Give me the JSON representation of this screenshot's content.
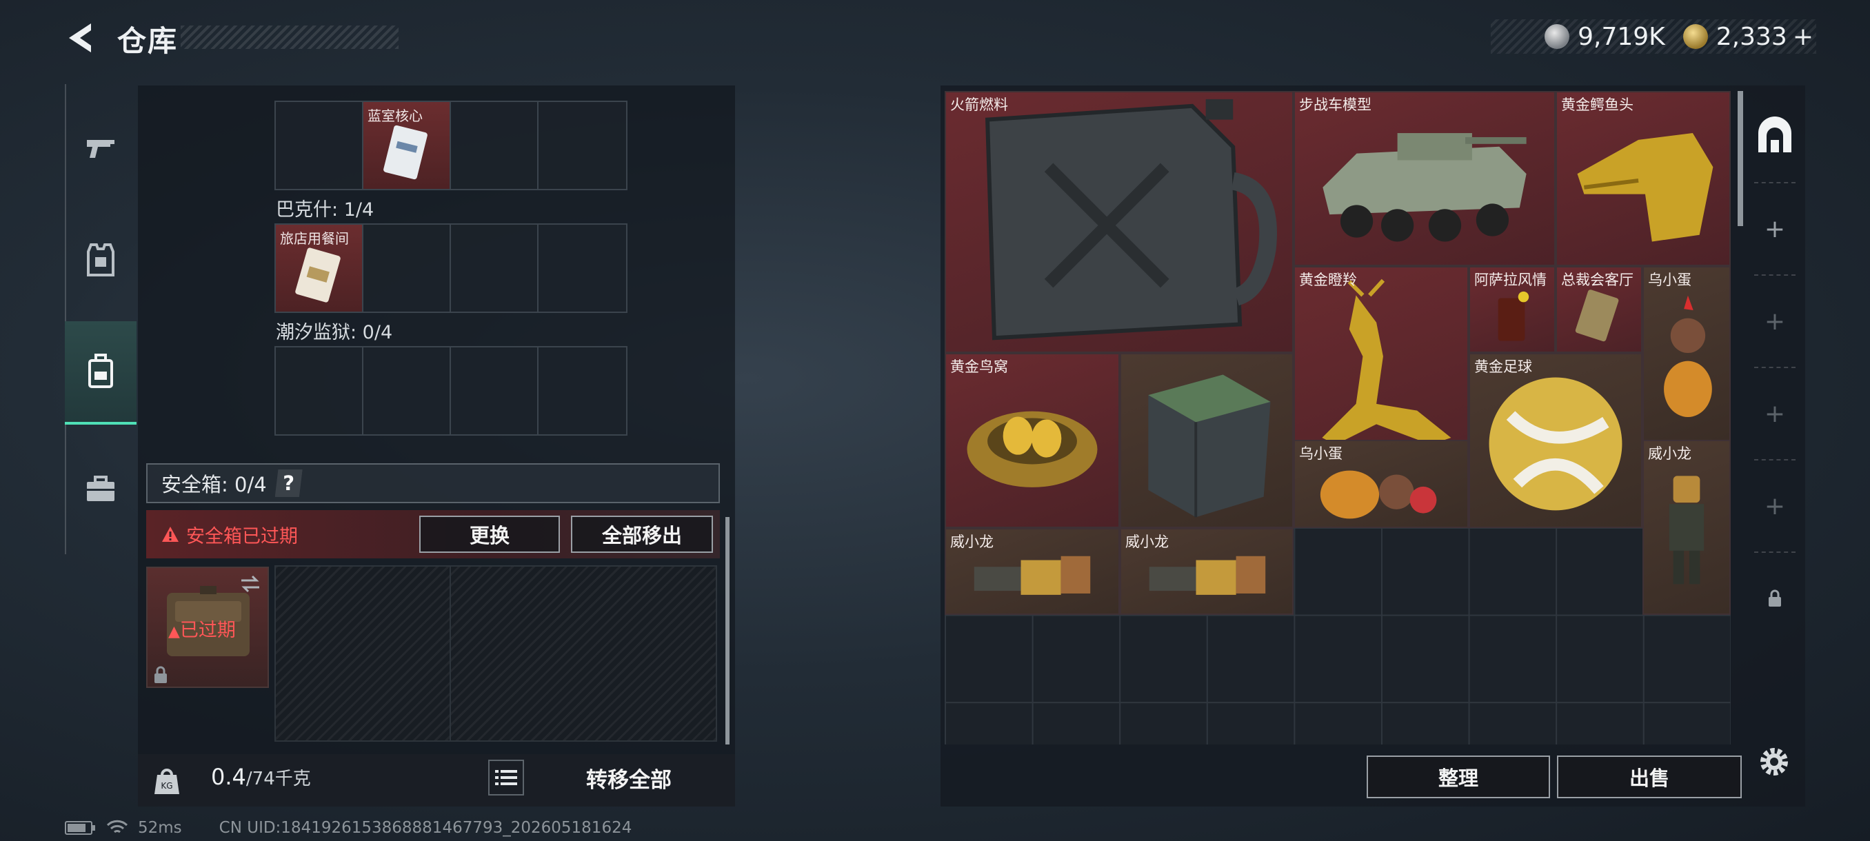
{
  "header": {
    "title": "仓库"
  },
  "currency": [
    {
      "icon": "silver-coin-icon",
      "value": "9,719K"
    },
    {
      "icon": "gold-coin-icon",
      "value": "2,333",
      "add_label": "+"
    }
  ],
  "left_tabs": [
    {
      "icon": "gun-icon"
    },
    {
      "icon": "armor-icon"
    },
    {
      "icon": "backpack-icon",
      "active": true
    },
    {
      "icon": "briefcase-icon"
    }
  ],
  "key_sections": [
    {
      "label": "",
      "items": [
        {
          "slot": 1,
          "name": "蓝室核心"
        }
      ]
    },
    {
      "label": "巴克什: 1/4",
      "items": [
        {
          "slot": 0,
          "name": "旅店用餐间"
        }
      ]
    },
    {
      "label": "潮汐监狱: 0/4",
      "items": []
    }
  ],
  "safe_box": {
    "label": "安全箱: 0/4",
    "help": "?",
    "warning": "安全箱已过期",
    "replace_label": "更换",
    "move_all_label": "全部移出",
    "case_status": "已过期"
  },
  "bottom": {
    "weight_value": "0.4",
    "weight_max": "/74千克",
    "transfer_label": "转移全部"
  },
  "status": {
    "ping": "52ms",
    "uid": "CN UID:1841926153868881467793_202605181624"
  },
  "stash": {
    "items": [
      {
        "name": "火箭燃料",
        "rarity": "red",
        "art": "jerrycan"
      },
      {
        "name": "步战车模型",
        "rarity": "red",
        "art": "ifv"
      },
      {
        "name": "黄金鳄鱼头",
        "rarity": "red",
        "art": "croc"
      },
      {
        "name": "黄金瞪羚",
        "rarity": "red",
        "art": "gazelle"
      },
      {
        "name": "阿萨拉风情",
        "rarity": "red",
        "art": "drink"
      },
      {
        "name": "总裁会客厅",
        "rarity": "red",
        "art": "card"
      },
      {
        "name": "乌小蛋",
        "rarity": "brown",
        "art": "egg"
      },
      {
        "name": "黄金鸟窝",
        "rarity": "red",
        "art": "nest"
      },
      {
        "name": "",
        "rarity": "brown",
        "art": "crate"
      },
      {
        "name": "黄金足球",
        "rarity": "brown",
        "art": "ball"
      },
      {
        "name": "乌小蛋",
        "rarity": "brown",
        "art": "egg"
      },
      {
        "name": "威小龙",
        "rarity": "brown",
        "art": "figure"
      },
      {
        "name": "威小龙",
        "rarity": "brown",
        "art": "dragon"
      },
      {
        "name": "威小龙",
        "rarity": "brown",
        "art": "dragon"
      }
    ],
    "sort_label": "整理",
    "sell_label": "出售"
  },
  "right_rail": [
    {
      "icon": "stash-icon"
    },
    {
      "icon": "plus-icon",
      "label": "+"
    },
    {
      "icon": "plus-icon",
      "label": "+"
    },
    {
      "icon": "plus-icon",
      "label": "+"
    },
    {
      "icon": "plus-icon",
      "label": "+"
    },
    {
      "icon": "lock-icon"
    }
  ]
}
